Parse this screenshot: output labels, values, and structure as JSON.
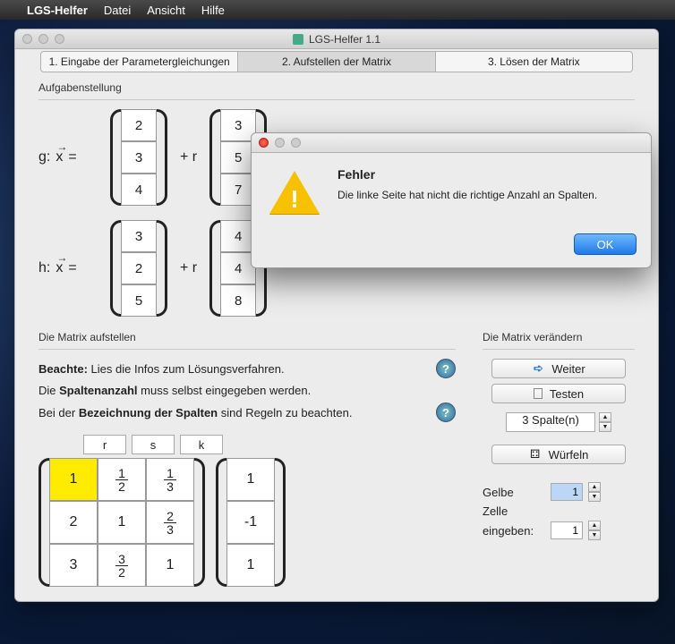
{
  "menubar": {
    "apple": "",
    "appname": "LGS-Helfer",
    "items": [
      "Datei",
      "Ansicht",
      "Hilfe"
    ]
  },
  "window": {
    "title": "LGS-Helfer 1.1"
  },
  "tabs": {
    "t1": "1. Eingabe der Parametergleichungen",
    "t2": "2. Aufstellen der Matrix",
    "t3": "3. Lösen der Matrix"
  },
  "labels": {
    "aufgaben": "Aufgabenstellung",
    "matrix_auf": "Die Matrix aufstellen",
    "matrix_ver": "Die Matrix verändern",
    "beachte_pre": "Beachte:",
    "beachte_rest": " Lies die Infos zum Lösungsverfahren.",
    "spalten_pre": "Die ",
    "spalten_b": "Spaltenanzahl",
    "spalten_rest": " muss selbst eingegeben werden.",
    "bez_pre": "Bei der ",
    "bez_b": "Bezeichnung der Spalten",
    "bez_rest": " sind Regeln zu beachten.",
    "help": "?"
  },
  "eq": {
    "g_label": "g:",
    "h_label": "h:",
    "x": "x",
    "eqsign": "=",
    "plus_r": "+ r",
    "g_v1": [
      "2",
      "3",
      "4"
    ],
    "g_v2": [
      "3",
      "5",
      "7"
    ],
    "h_v1": [
      "3",
      "2",
      "5"
    ],
    "h_v2": [
      "4",
      "4",
      "8"
    ]
  },
  "matrix": {
    "heads": [
      "r",
      "s",
      "k"
    ],
    "rows": [
      [
        "1",
        "1/2",
        "1/3"
      ],
      [
        "2",
        "1",
        "2/3"
      ],
      [
        "3",
        "3/2",
        "1"
      ]
    ],
    "rhs": [
      "1",
      "-1",
      "1"
    ]
  },
  "rpanel": {
    "weiter": "Weiter",
    "testen": "Testen",
    "spalten": "3 Spalte(n)",
    "wuerfeln": "Würfeln",
    "gelbe1": "Gelbe",
    "gelbe2": "Zelle",
    "gelbe3": "eingeben:",
    "val1": "1",
    "val2": "1"
  },
  "dialog": {
    "title": "Fehler",
    "message": "Die linke Seite hat nicht die richtige Anzahl an Spalten.",
    "ok": "OK"
  }
}
